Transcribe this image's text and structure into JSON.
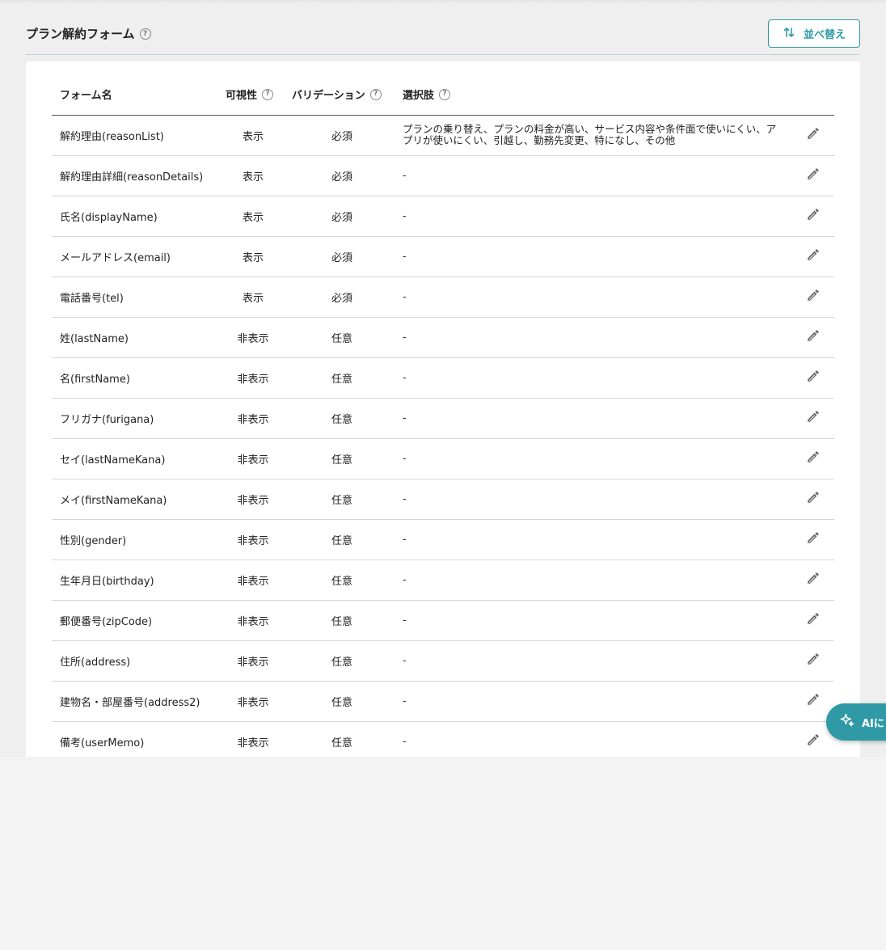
{
  "header": {
    "title": "プラン解約フォーム",
    "help": "?",
    "sort_label": "並べ替え"
  },
  "table": {
    "columns": {
      "name": "フォーム名",
      "visibility": "可視性",
      "validation": "バリデーション",
      "options": "選択肢"
    },
    "rows": [
      {
        "name": "解約理由(reasonList)",
        "visibility": "表示",
        "validation": "必須",
        "options": "プランの乗り替え、プランの料金が高い、サービス内容や条件面で使いにくい、アプリが使いにくい、引越し、勤務先変更、特になし、その他"
      },
      {
        "name": "解約理由詳細(reasonDetails)",
        "visibility": "表示",
        "validation": "必須",
        "options": "-"
      },
      {
        "name": "氏名(displayName)",
        "visibility": "表示",
        "validation": "必須",
        "options": "-"
      },
      {
        "name": "メールアドレス(email)",
        "visibility": "表示",
        "validation": "必須",
        "options": "-"
      },
      {
        "name": "電話番号(tel)",
        "visibility": "表示",
        "validation": "必須",
        "options": "-"
      },
      {
        "name": "姓(lastName)",
        "visibility": "非表示",
        "validation": "任意",
        "options": "-"
      },
      {
        "name": "名(firstName)",
        "visibility": "非表示",
        "validation": "任意",
        "options": "-"
      },
      {
        "name": "フリガナ(furigana)",
        "visibility": "非表示",
        "validation": "任意",
        "options": "-"
      },
      {
        "name": "セイ(lastNameKana)",
        "visibility": "非表示",
        "validation": "任意",
        "options": "-"
      },
      {
        "name": "メイ(firstNameKana)",
        "visibility": "非表示",
        "validation": "任意",
        "options": "-"
      },
      {
        "name": "性別(gender)",
        "visibility": "非表示",
        "validation": "任意",
        "options": "-"
      },
      {
        "name": "生年月日(birthday)",
        "visibility": "非表示",
        "validation": "任意",
        "options": "-"
      },
      {
        "name": "郵便番号(zipCode)",
        "visibility": "非表示",
        "validation": "任意",
        "options": "-"
      },
      {
        "name": "住所(address)",
        "visibility": "非表示",
        "validation": "任意",
        "options": "-"
      },
      {
        "name": "建物名・部屋番号(address2)",
        "visibility": "非表示",
        "validation": "任意",
        "options": "-"
      },
      {
        "name": "備考(userMemo)",
        "visibility": "非表示",
        "validation": "任意",
        "options": "-"
      }
    ]
  },
  "ai_button": {
    "label": "AIに"
  },
  "icons": {
    "sort": "sort-arrows-icon",
    "edit": "pencil-icon",
    "help": "question-circle-icon",
    "ai": "sparkle-icon"
  },
  "colors": {
    "accent": "#2f9aa6"
  }
}
